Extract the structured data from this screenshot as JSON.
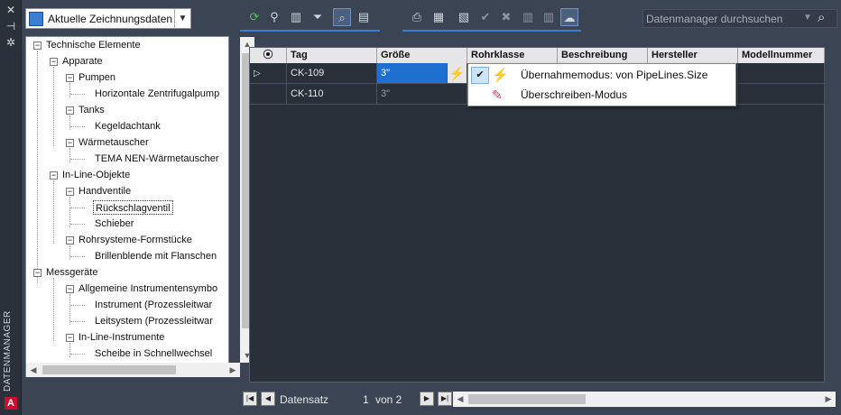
{
  "strip": {
    "close_icon": "✕",
    "pin_icon": "⊣",
    "settings_icon": "✲",
    "label": "DATENMANAGER",
    "logo": "A"
  },
  "combo": {
    "value": "Aktuelle Zeichnungsdaten",
    "dropdown_icon": "chevron-down-icon"
  },
  "tree": {
    "nodes": [
      {
        "label": "Technische Elemente"
      },
      {
        "label": "Apparate"
      },
      {
        "label": "Pumpen"
      },
      {
        "label": "Horizontale Zentrifugalpump"
      },
      {
        "label": "Tanks"
      },
      {
        "label": "Kegeldachtank"
      },
      {
        "label": "Wärmetauscher"
      },
      {
        "label": "TEMA NEN-Wärmetauscher"
      },
      {
        "label": "In-Line-Objekte"
      },
      {
        "label": "Handventile"
      },
      {
        "label": "Rückschlagventil"
      },
      {
        "label": "Schieber"
      },
      {
        "label": "Rohrsysteme-Formstücke"
      },
      {
        "label": "Brillenblende mit Flanschen"
      },
      {
        "label": "Messgeräte"
      },
      {
        "label": "Allgemeine Instrumentensymbo"
      },
      {
        "label": "Instrument (Prozessleitwar"
      },
      {
        "label": "Leitsystem (Prozessleitwar"
      },
      {
        "label": "In-Line-Instrumente"
      },
      {
        "label": "Scheibe in Schnellwechsel"
      }
    ],
    "selected": "Rückschlagventil"
  },
  "search": {
    "placeholder": "Datenmanager durchsuchen"
  },
  "grid": {
    "columns": [
      "Tag",
      "Größe",
      "Rohrklasse",
      "Beschreibung",
      "Hersteller",
      "Modellnummer"
    ],
    "rows": [
      {
        "tag": "CK-109",
        "size": "3\"",
        "current": true
      },
      {
        "tag": "CK-110",
        "size": "3\""
      }
    ]
  },
  "popup": {
    "items": [
      {
        "label": "Übernahmemodus: von PipeLines.Size",
        "checked": true,
        "icon": "lightning-icon"
      },
      {
        "label": "Überschreiben-Modus",
        "checked": false,
        "icon": "pencil-icon"
      }
    ]
  },
  "nav": {
    "label": "Datensatz",
    "current": "1",
    "of_label": "von 2"
  },
  "colors": {
    "background": "#3b4453",
    "accent": "#3a7fd5",
    "edit_cell": "#1f6fd1",
    "lightning": "#f0a800"
  }
}
